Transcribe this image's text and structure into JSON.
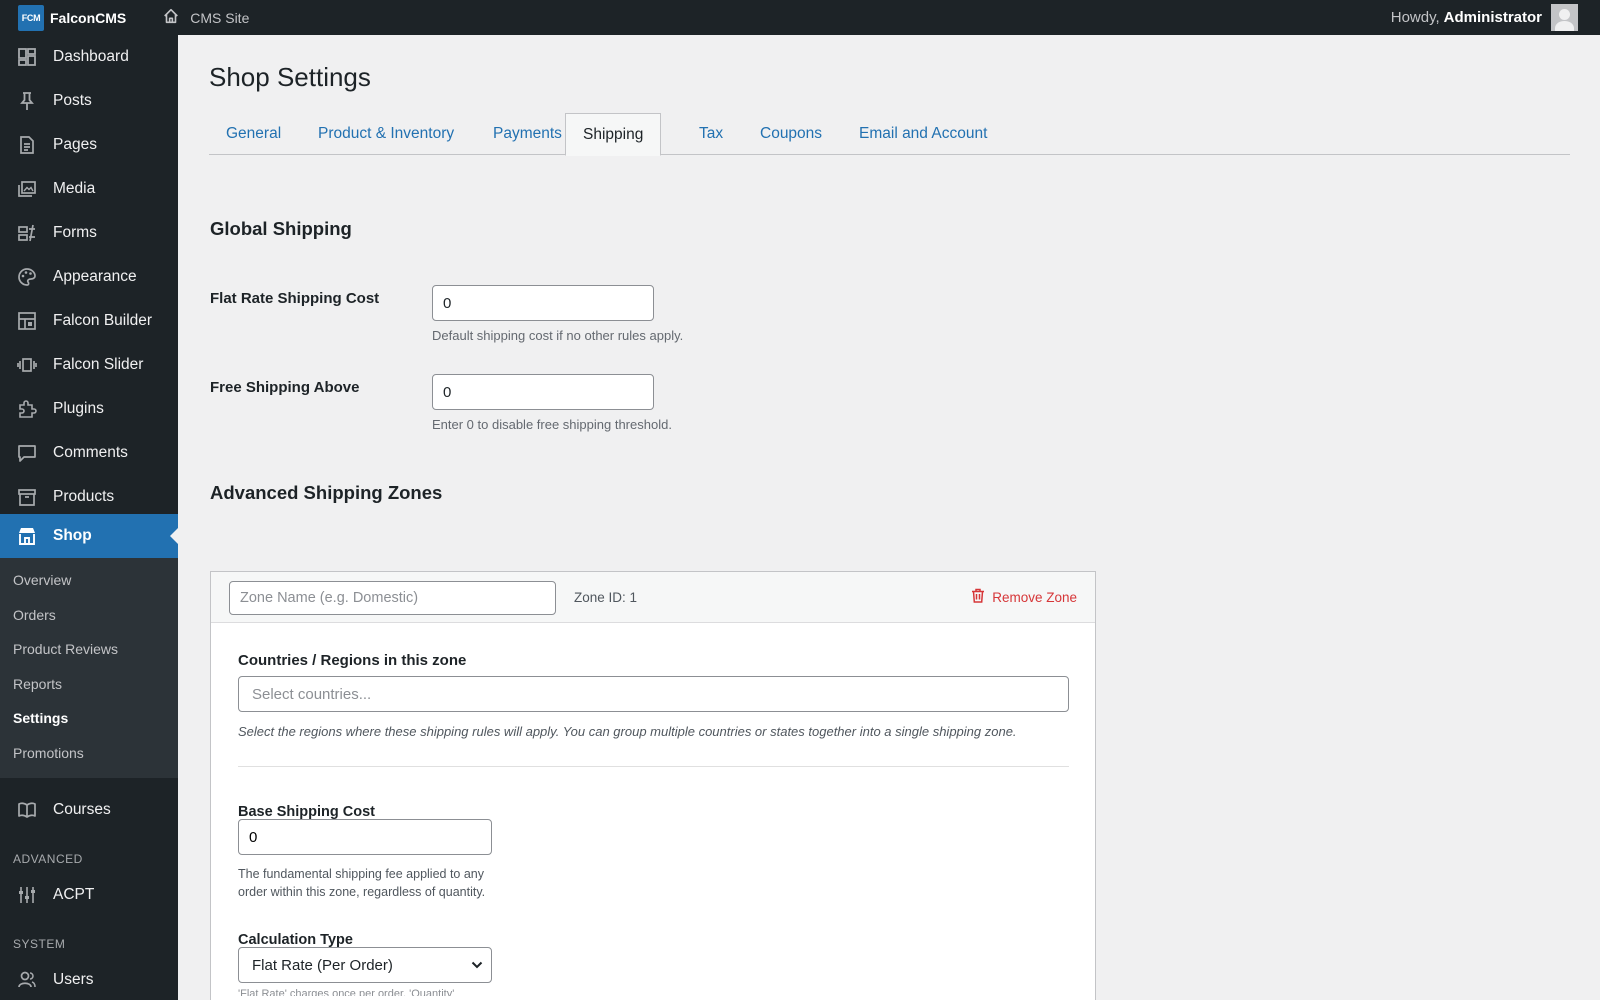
{
  "topbar": {
    "logo_text": "FCM",
    "brand": "FalconCMS",
    "site_link": "CMS Site",
    "howdy": "Howdy,",
    "user": "Administrator"
  },
  "sidebar": {
    "items": [
      {
        "label": "Dashboard",
        "icon": "dashboard-icon"
      },
      {
        "label": "Posts",
        "icon": "pin-icon"
      },
      {
        "label": "Pages",
        "icon": "page-icon"
      },
      {
        "label": "Media",
        "icon": "media-icon"
      },
      {
        "label": "Forms",
        "icon": "forms-icon"
      },
      {
        "label": "Appearance",
        "icon": "palette-icon"
      },
      {
        "label": "Falcon Builder",
        "icon": "layout-icon"
      },
      {
        "label": "Falcon Slider",
        "icon": "slider-icon"
      },
      {
        "label": "Plugins",
        "icon": "plugin-icon"
      },
      {
        "label": "Comments",
        "icon": "comment-icon"
      },
      {
        "label": "Products",
        "icon": "archive-icon"
      },
      {
        "label": "Shop",
        "icon": "store-icon",
        "active": true
      }
    ],
    "shop_submenu": [
      "Overview",
      "Orders",
      "Product Reviews",
      "Reports",
      "Settings",
      "Promotions"
    ],
    "shop_submenu_current": "Settings",
    "courses": {
      "label": "Courses",
      "icon": "book-icon"
    },
    "section_advanced": "ADVANCED",
    "acpt": {
      "label": "ACPT",
      "icon": "sliders-icon"
    },
    "section_system": "SYSTEM",
    "users": {
      "label": "Users",
      "icon": "users-icon"
    }
  },
  "page": {
    "title": "Shop Settings",
    "tabs": [
      "General",
      "Product & Inventory",
      "Payments",
      "Shipping",
      "Tax",
      "Coupons",
      "Email and Account"
    ],
    "active_tab": "Shipping"
  },
  "global_shipping": {
    "heading": "Global Shipping",
    "flat_rate_label": "Flat Rate Shipping Cost",
    "flat_rate_value": "0",
    "flat_rate_desc": "Default shipping cost if no other rules apply.",
    "free_above_label": "Free Shipping Above",
    "free_above_value": "0",
    "free_above_desc": "Enter 0 to disable free shipping threshold."
  },
  "zones": {
    "heading": "Advanced Shipping Zones",
    "zone": {
      "name_placeholder": "Zone Name (e.g. Domestic)",
      "zone_id": "Zone ID: 1",
      "remove_label": "Remove Zone",
      "countries_label": "Countries / Regions in this zone",
      "countries_placeholder": "Select countries...",
      "countries_desc": "Select the regions where these shipping rules will apply. You can group multiple countries or states together into a single shipping zone.",
      "base_cost_label": "Base Shipping Cost",
      "base_cost_value": "0",
      "base_cost_desc": "The fundamental shipping fee applied to any order within this zone, regardless of quantity.",
      "calc_type_label": "Calculation Type",
      "calc_type_value": "Flat Rate (Per Order)",
      "calc_type_hint": "'Flat Rate' charges once per order. 'Quantity'"
    }
  },
  "colors": {
    "admin_bar": "#1d2327",
    "accent": "#2271b1",
    "danger": "#d63638",
    "submenu_bg": "#2c3338"
  }
}
